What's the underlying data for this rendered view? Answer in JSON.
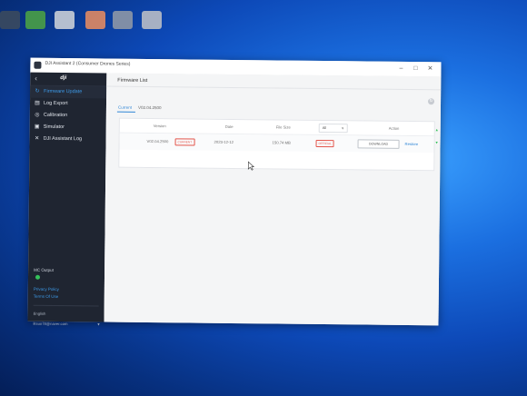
{
  "window": {
    "title": "DJI Assistant 2 (Consumer Drones Series)",
    "buttons": {
      "minimize": "–",
      "maximize": "□",
      "close": "✕"
    }
  },
  "sidebar": {
    "back": "‹",
    "brand": "dji",
    "items": [
      {
        "label": "Firmware Update",
        "icon": "firmware-icon",
        "glyph": "↻",
        "active": true
      },
      {
        "label": "Log Export",
        "icon": "log-export-icon",
        "glyph": "▤",
        "active": false
      },
      {
        "label": "Calibration",
        "icon": "calibration-icon",
        "glyph": "◎",
        "active": false
      },
      {
        "label": "Simulator",
        "icon": "simulator-icon",
        "glyph": "▣",
        "active": false
      },
      {
        "label": "DJI Assistant Log",
        "icon": "tools-icon",
        "glyph": "✕",
        "active": false
      }
    ],
    "mc_output": "MC Output",
    "privacy": "Privacy Policy",
    "terms": "Terms Of Use",
    "language": "English",
    "account": "litsuo78@naver.com",
    "account_caret": "▼"
  },
  "main": {
    "header": "Firmware List",
    "current_label": "Current",
    "current_value": "V02.04.2500",
    "sync_glyph": "↻",
    "table": {
      "headers": {
        "version": "Version",
        "date": "Date",
        "size": "File Size",
        "filter": "All",
        "filter_caret": "∨",
        "action": "Action"
      },
      "rows": [
        {
          "version": "V02.04.2500",
          "tag": "CURRENT",
          "date": "2023-12-12",
          "size": "150.74 MB",
          "status": "OFFICIAL",
          "download": "DOWNLOAD",
          "restore": "Restore"
        }
      ]
    },
    "arrows": {
      "up": "▲",
      "down": "▼"
    }
  },
  "colors": {
    "accent": "#2f86d6",
    "sidebar_bg": "#1f2531",
    "tag_red": "#e3544a",
    "status_green": "#35c15a"
  }
}
